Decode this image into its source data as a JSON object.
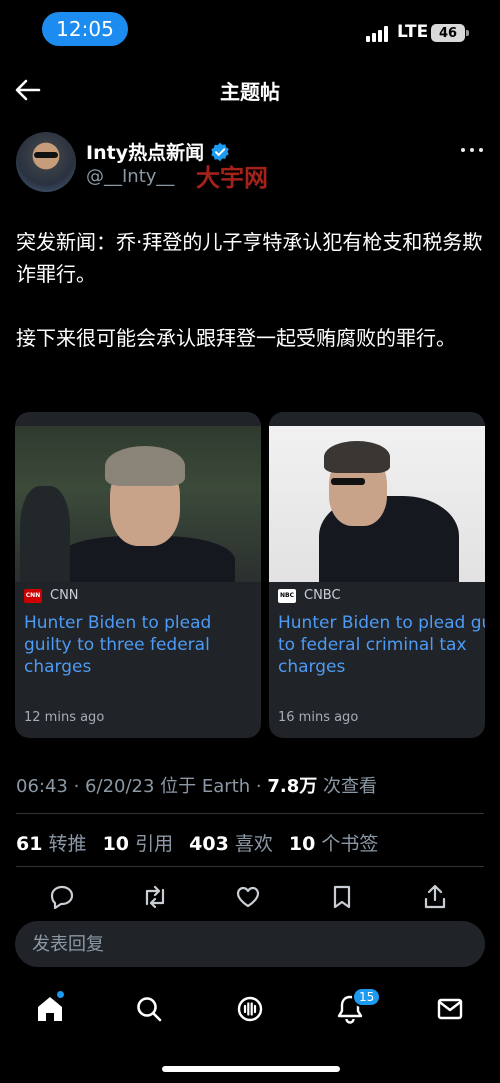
{
  "status_bar": {
    "time": "12:05",
    "network": "LTE",
    "battery": "46"
  },
  "header": {
    "title": "主题帖",
    "back_icon": "arrow-left-icon"
  },
  "author": {
    "name": "Inty热点新闻",
    "handle": "@__Inty__",
    "verified_icon": "verified-badge-icon",
    "watermark": "大宇网"
  },
  "tweet": {
    "paragraphs": [
      "突发新闻：乔·拜登的儿子亨特承认犯有枪支和税务欺诈罪行。",
      "接下来很可能会承认跟拜登一起受贿腐败的罪行。"
    ]
  },
  "cards": [
    {
      "source": "CNN",
      "logo_text": "CNN",
      "headline": "Hunter Biden to plead guilty to three federal charges",
      "time": "12 mins ago"
    },
    {
      "source": "CNBC",
      "logo_text": "NBC",
      "headline": "Hunter Biden to plead guilty to federal criminal tax charges",
      "time": "16 mins ago"
    }
  ],
  "meta": {
    "time": "06:43",
    "date": "6/20/23",
    "location": "位于 Earth",
    "views": "7.8万",
    "views_label": "次查看"
  },
  "stats": {
    "retweets": "61",
    "retweets_label": "转推",
    "quotes": "10",
    "quotes_label": "引用",
    "likes": "403",
    "likes_label": "喜欢",
    "bookmarks": "10",
    "bookmarks_label": "个书签"
  },
  "reply": {
    "placeholder": "发表回复"
  },
  "nav": {
    "notifications_badge": "15"
  },
  "colors": {
    "accent": "#1d9bf0",
    "link": "#4d9bf5",
    "background": "#000000",
    "card": "#202327",
    "muted": "#8b98a5"
  }
}
